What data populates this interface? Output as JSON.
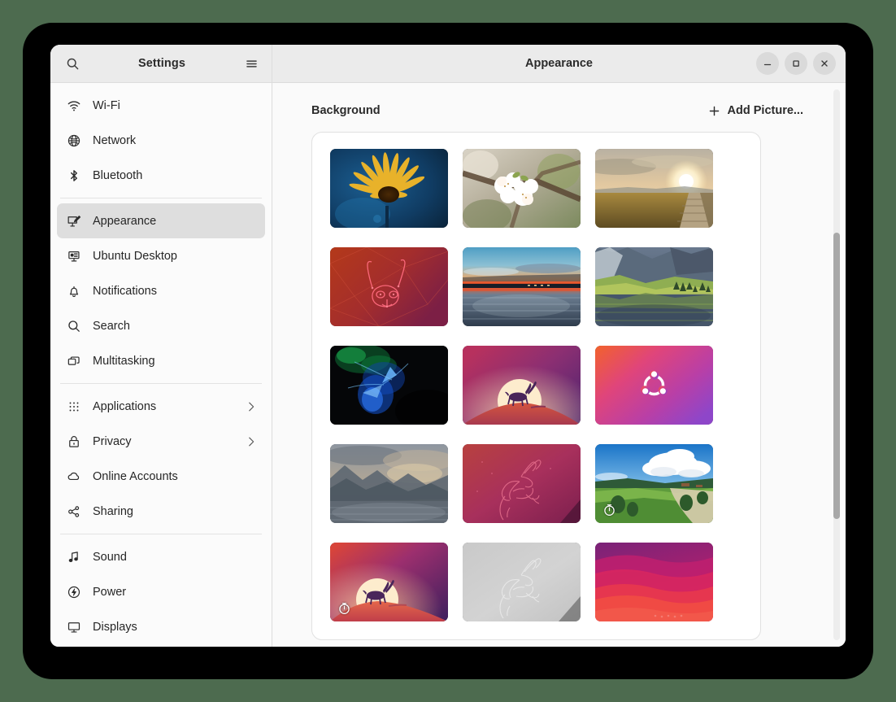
{
  "window": {
    "app_title": "Settings",
    "page_title": "Appearance",
    "search_icon": "search-icon",
    "menu_icon": "hamburger-menu-icon",
    "minimize_label": "Minimize",
    "maximize_label": "Maximize",
    "close_label": "Close"
  },
  "sidebar": {
    "groups": [
      {
        "items": [
          {
            "label": "Wi-Fi",
            "icon": "wifi-icon",
            "selected": false,
            "chevron": false
          },
          {
            "label": "Network",
            "icon": "network-icon",
            "selected": false,
            "chevron": false
          },
          {
            "label": "Bluetooth",
            "icon": "bluetooth-icon",
            "selected": false,
            "chevron": false
          }
        ]
      },
      {
        "items": [
          {
            "label": "Appearance",
            "icon": "appearance-icon",
            "selected": true,
            "chevron": false
          },
          {
            "label": "Ubuntu Desktop",
            "icon": "ubuntu-desktop-icon",
            "selected": false,
            "chevron": false
          },
          {
            "label": "Notifications",
            "icon": "bell-icon",
            "selected": false,
            "chevron": false
          },
          {
            "label": "Search",
            "icon": "search-icon",
            "selected": false,
            "chevron": false
          },
          {
            "label": "Multitasking",
            "icon": "multitasking-icon",
            "selected": false,
            "chevron": false
          }
        ]
      },
      {
        "items": [
          {
            "label": "Applications",
            "icon": "grid-apps-icon",
            "selected": false,
            "chevron": true
          },
          {
            "label": "Privacy",
            "icon": "lock-icon",
            "selected": false,
            "chevron": true
          },
          {
            "label": "Online Accounts",
            "icon": "cloud-icon",
            "selected": false,
            "chevron": false
          },
          {
            "label": "Sharing",
            "icon": "share-icon",
            "selected": false,
            "chevron": false
          }
        ]
      },
      {
        "items": [
          {
            "label": "Sound",
            "icon": "music-note-icon",
            "selected": false,
            "chevron": false
          },
          {
            "label": "Power",
            "icon": "power-icon",
            "selected": false,
            "chevron": false
          },
          {
            "label": "Displays",
            "icon": "display-icon",
            "selected": false,
            "chevron": false
          }
        ]
      }
    ]
  },
  "main": {
    "section_label": "Background",
    "add_picture_label": "Add Picture...",
    "add_icon": "plus-icon",
    "wallpapers": [
      {
        "name": "yellow-daisy-on-blue",
        "badge": null
      },
      {
        "name": "white-cherry-blossom",
        "badge": null
      },
      {
        "name": "golden-field-boardwalk-sunset",
        "badge": null
      },
      {
        "name": "red-kudu-geometric",
        "badge": null
      },
      {
        "name": "lake-sunset-reflection",
        "badge": null
      },
      {
        "name": "green-mountain-lake",
        "badge": null
      },
      {
        "name": "blue-green-abstract-dark",
        "badge": null
      },
      {
        "name": "kudu-moonrise-purple",
        "badge": null
      },
      {
        "name": "ubuntu-logo-gradient",
        "badge": null
      },
      {
        "name": "grey-misty-mountains-lake",
        "badge": null
      },
      {
        "name": "pink-leaping-antelope-outline",
        "badge": null
      },
      {
        "name": "green-countryside-road",
        "badge": "timer-icon"
      },
      {
        "name": "kudu-moonrise-dark",
        "badge": "timer-icon"
      },
      {
        "name": "grey-leaping-antelope-outline",
        "badge": null
      },
      {
        "name": "pink-orange-waves",
        "badge": null
      }
    ]
  },
  "scrollbar": {
    "thumb_top_percent": 26,
    "thumb_height_percent": 52
  },
  "colors": {
    "window_bg": "#fafafa",
    "titlebar_bg": "#ebebeb",
    "sidebar_bg": "#fbfbfb",
    "selected_item": "#dedede",
    "desktop_bg": "#4d6b4f",
    "bezel": "#000000"
  }
}
